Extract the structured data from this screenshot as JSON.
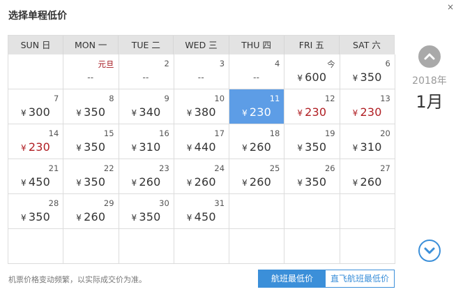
{
  "title": "选择单程低价",
  "close_label": "×",
  "weekdays": [
    "SUN 日",
    "MON 一",
    "TUE 二",
    "WED 三",
    "THU 四",
    "FRI 五",
    "SAT 六"
  ],
  "calendar": {
    "year_label": "2018年",
    "month_label": "1月",
    "currency": "¥",
    "cells": [
      {
        "day": "",
        "price": ""
      },
      {
        "day": "元旦",
        "price": "--",
        "holiday": true
      },
      {
        "day": "2",
        "price": "--"
      },
      {
        "day": "3",
        "price": "--"
      },
      {
        "day": "4",
        "price": "--"
      },
      {
        "day": "今",
        "price": "600"
      },
      {
        "day": "6",
        "price": "350"
      },
      {
        "day": "7",
        "price": "300"
      },
      {
        "day": "8",
        "price": "350"
      },
      {
        "day": "9",
        "price": "340"
      },
      {
        "day": "10",
        "price": "380"
      },
      {
        "day": "11",
        "price": "230",
        "selected": true
      },
      {
        "day": "12",
        "price": "230",
        "low": true
      },
      {
        "day": "13",
        "price": "230",
        "low": true
      },
      {
        "day": "14",
        "price": "230",
        "low": true
      },
      {
        "day": "15",
        "price": "350"
      },
      {
        "day": "16",
        "price": "310"
      },
      {
        "day": "17",
        "price": "440"
      },
      {
        "day": "18",
        "price": "260"
      },
      {
        "day": "19",
        "price": "350"
      },
      {
        "day": "20",
        "price": "310"
      },
      {
        "day": "21",
        "price": "450"
      },
      {
        "day": "22",
        "price": "350"
      },
      {
        "day": "23",
        "price": "260"
      },
      {
        "day": "24",
        "price": "260"
      },
      {
        "day": "25",
        "price": "260"
      },
      {
        "day": "26",
        "price": "350"
      },
      {
        "day": "27",
        "price": "260"
      },
      {
        "day": "28",
        "price": "350"
      },
      {
        "day": "29",
        "price": "260"
      },
      {
        "day": "30",
        "price": "350"
      },
      {
        "day": "31",
        "price": "450"
      },
      {
        "day": "",
        "price": ""
      },
      {
        "day": "",
        "price": ""
      },
      {
        "day": "",
        "price": ""
      },
      {
        "day": "",
        "price": ""
      },
      {
        "day": "",
        "price": ""
      },
      {
        "day": "",
        "price": ""
      },
      {
        "day": "",
        "price": ""
      },
      {
        "day": "",
        "price": ""
      },
      {
        "day": "",
        "price": ""
      },
      {
        "day": "",
        "price": ""
      }
    ]
  },
  "footnote": "机票价格变动频繁，以实际成交价为准。",
  "toggle": {
    "lowest_label": "航班最低价",
    "direct_label": "直飞航班最低价"
  },
  "colors": {
    "accent": "#3b8fd9",
    "selected_bg": "#5d9de6",
    "low_price": "#b01e23",
    "header_bg": "#e3e3e3"
  },
  "icons": {
    "prev_month": "chevron-up-icon",
    "next_month": "chevron-down-icon",
    "close": "close-icon"
  }
}
